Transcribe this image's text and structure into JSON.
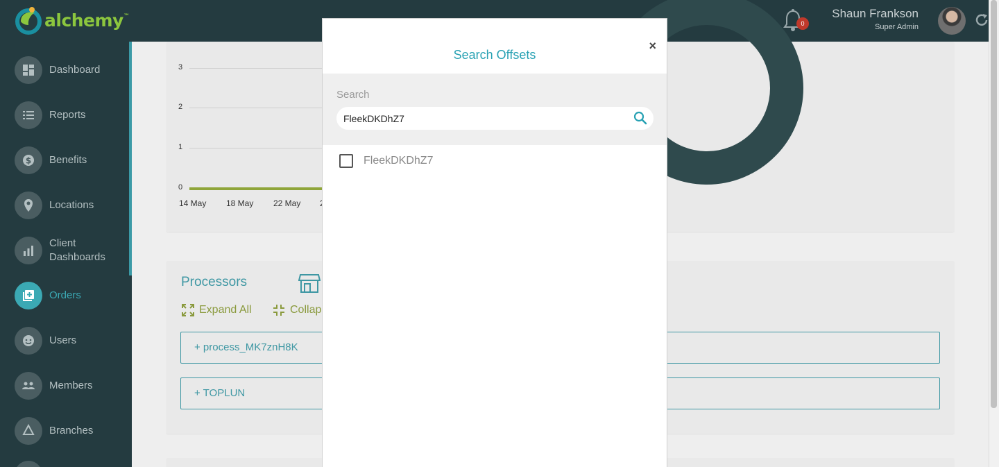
{
  "brand": {
    "name": "alchemy",
    "tm": "™"
  },
  "header": {
    "notifications_count": "0",
    "user_name": "Shaun Frankson",
    "user_role": "Super Admin"
  },
  "sidebar": {
    "items": [
      {
        "label": "Dashboard",
        "icon": "dashboard-icon"
      },
      {
        "label": "Reports",
        "icon": "list-icon"
      },
      {
        "label": "Benefits",
        "icon": "dollar-icon"
      },
      {
        "label": "Locations",
        "icon": "map-pin-icon"
      },
      {
        "label": "Client Dashboards",
        "icon": "chart-icon"
      },
      {
        "label": "Orders",
        "icon": "add-box-icon",
        "active": true
      },
      {
        "label": "Users",
        "icon": "face-icon"
      },
      {
        "label": "Members",
        "icon": "group-icon"
      },
      {
        "label": "Branches",
        "icon": "recycle-icon"
      }
    ]
  },
  "chart_data": {
    "type": "line",
    "x": [
      "14 May",
      "18 May",
      "22 May",
      "2"
    ],
    "y_ticks": [
      "3",
      "2",
      "1",
      "0"
    ],
    "ylim": [
      0,
      3
    ]
  },
  "processors": {
    "title": "Processors",
    "expand_all": "Expand All",
    "collapse_all": "Collap",
    "rows": [
      "+ process_MK7znH8K",
      "+ TOPLUN"
    ]
  },
  "modal": {
    "title": "Search Offsets",
    "close": "×",
    "search_label": "Search",
    "search_value": "FleekDKDhZ7",
    "results": [
      {
        "label": "FleekDKDhZ7",
        "checked": false
      }
    ]
  },
  "colors": {
    "header_bg": "#243b40",
    "accent": "#27a1b3",
    "brand_green": "#8cc63e",
    "chart_line": "#8fa53a"
  }
}
